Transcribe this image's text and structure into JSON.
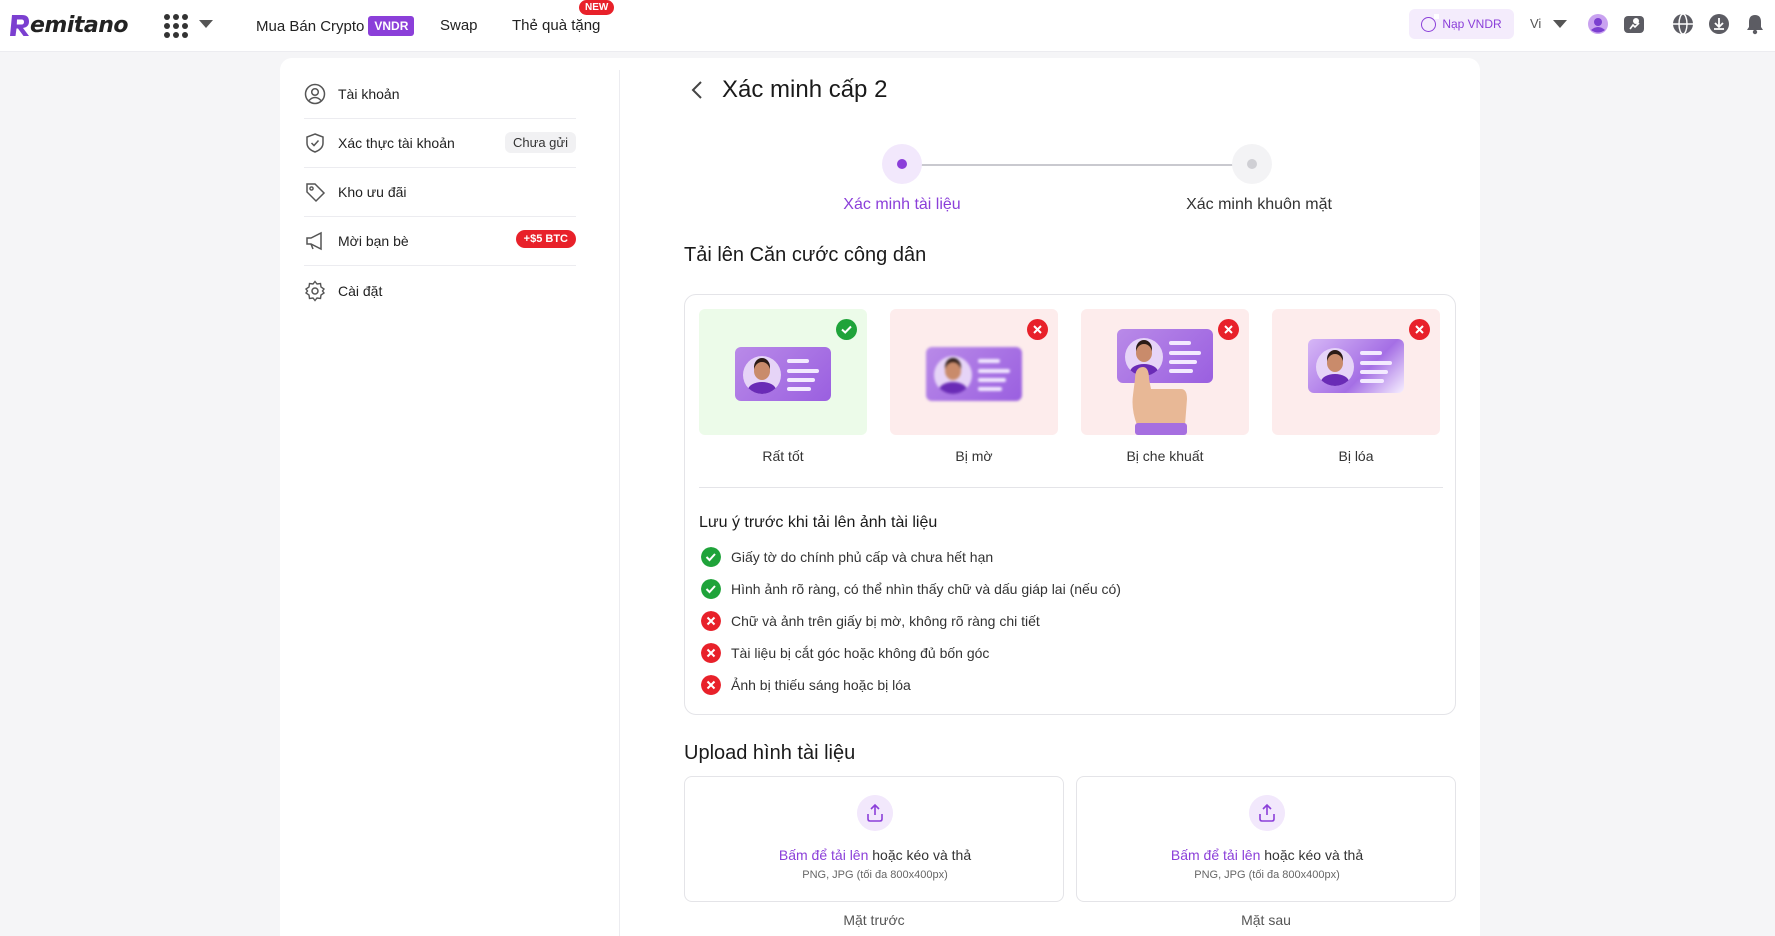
{
  "header": {
    "logo_text": "emitano",
    "nav": {
      "buy_sell": "Mua Bán Crypto",
      "vndr_badge": "VNDR",
      "swap": "Swap",
      "gift": "Thẻ quà tặng",
      "new_badge": "NEW"
    },
    "deposit_button": "Nạp VNDR",
    "language": "Vi"
  },
  "sidebar": {
    "items": [
      {
        "label": "Tài khoản",
        "icon": "user-circle-icon"
      },
      {
        "label": "Xác thực tài khoản",
        "icon": "shield-check-icon",
        "badge": "Chưa gửi"
      },
      {
        "label": "Kho ưu đãi",
        "icon": "tag-icon"
      },
      {
        "label": "Mời bạn bè",
        "icon": "megaphone-icon",
        "badge": "+$5 BTC"
      },
      {
        "label": "Cài đặt",
        "icon": "gear-icon"
      }
    ]
  },
  "main": {
    "title": "Xác minh cấp 2",
    "steps": [
      "Xác minh tài liệu",
      "Xác minh khuôn mặt"
    ],
    "active_step": 1,
    "upload_id_title": "Tải lên Căn cước công dân",
    "samples": [
      {
        "label": "Rất tốt",
        "status": "ok"
      },
      {
        "label": "Bị mờ",
        "status": "bad"
      },
      {
        "label": "Bị che khuất",
        "status": "bad"
      },
      {
        "label": "Bị lóa",
        "status": "bad"
      }
    ],
    "notes_title": "Lưu ý trước khi tải lên ảnh tài liệu",
    "notes": [
      {
        "text": "Giấy tờ do chính phủ cấp và chưa hết hạn",
        "status": "ok"
      },
      {
        "text": "Hình ảnh rõ ràng, có thể nhìn thấy chữ và dấu giáp lai (nếu có)",
        "status": "ok"
      },
      {
        "text": "Chữ và ảnh trên giấy bị mờ, không rõ ràng chi tiết",
        "status": "bad"
      },
      {
        "text": "Tài liệu bị cắt góc hoặc không đủ bốn góc",
        "status": "bad"
      },
      {
        "text": "Ảnh bị thiếu sáng hoặc bị lóa",
        "status": "bad"
      }
    ],
    "upload_title": "Upload hình tài liệu",
    "upload": {
      "link_text": "Bấm để tải lên",
      "rest_text": " hoặc kéo và thả",
      "hint": "PNG, JPG (tối đa 800x400px)",
      "front_label": "Mặt trước",
      "back_label": "Mặt sau"
    }
  },
  "colors": {
    "accent": "#8b3fd9",
    "success": "#1fa33a",
    "danger": "#e8212a",
    "good_bg": "#ecfbe9",
    "bad_bg": "#fdecec"
  }
}
